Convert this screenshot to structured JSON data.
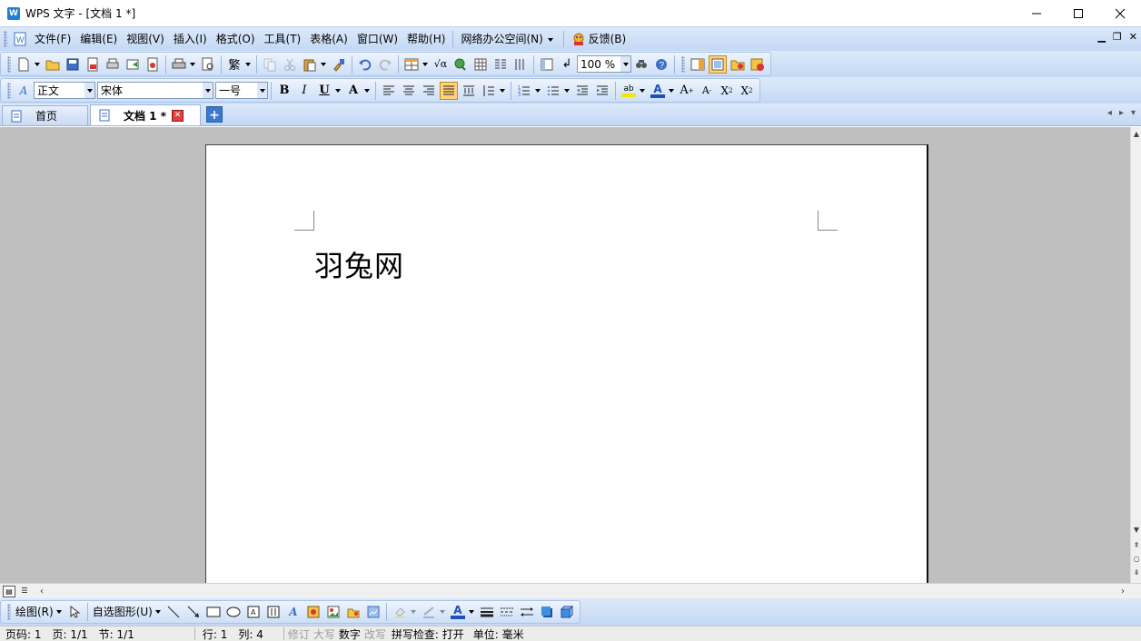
{
  "window": {
    "title": "WPS 文字 - [文档 1 *]",
    "app_icon_label": "W"
  },
  "menubar": {
    "items": [
      "文件(F)",
      "编辑(E)",
      "视图(V)",
      "插入(I)",
      "格式(O)",
      "工具(T)",
      "表格(A)",
      "窗口(W)",
      "帮助(H)"
    ],
    "network_office": "网络办公空间(N)",
    "feedback": "反馈(B)"
  },
  "toolbar": {
    "zoom": "100 %"
  },
  "format": {
    "style": "正文",
    "font": "宋体",
    "size": "一号",
    "bold": "B",
    "italic": "I",
    "underline": "U",
    "char_scale": "A",
    "font_color": "A",
    "grow": "A",
    "shrink": "A",
    "superscript": "X",
    "subscript": "X",
    "highlight": "ab"
  },
  "tabs": {
    "home": "首页",
    "doc": "文档 1 *"
  },
  "document": {
    "text": "羽兔网"
  },
  "drawbar": {
    "draw": "绘图(R)",
    "autoshape": "自选图形(U)",
    "text_color_glyph": "A"
  },
  "status": {
    "page_no": "页码: 1",
    "page": "页: 1/1",
    "section": "节: 1/1",
    "line": "行: 1",
    "col": "列: 4",
    "revise": "修订",
    "caps": "大写",
    "num": "数字",
    "overwrite": "改写",
    "spell": "拼写检查: 打开",
    "unit": "单位: 毫米"
  },
  "colors": {
    "accent": "#1f7fd8",
    "bar_bg": "#c4d8f4",
    "workspace": "#bfbfbf",
    "close_red": "#e04040"
  }
}
